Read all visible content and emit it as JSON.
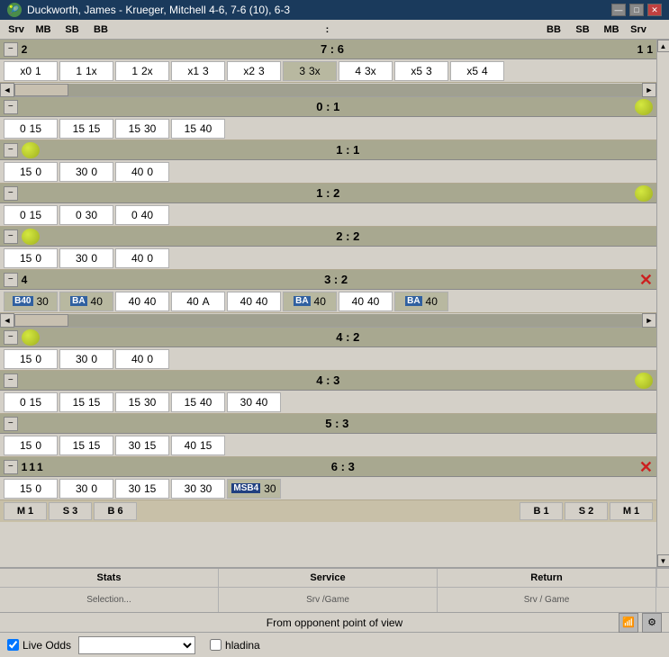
{
  "titleBar": {
    "title": "Duckworth, James - Krueger, Mitchell 4-6, 7-6 (10), 6-3",
    "icon": "🎾",
    "minimize": "—",
    "maximize": "□",
    "close": "✕"
  },
  "header": {
    "srv": "Srv",
    "mb": "MB",
    "sb": "SB",
    "bb": "BB",
    "colon": ":",
    "bb2": "BB",
    "sb2": "SB",
    "mb2": "MB",
    "srv2": "Srv"
  },
  "sets": [
    {
      "id": "set1",
      "hasBall": false,
      "score": "7 : 6",
      "leftNums": {
        "mb": "2",
        "sb": "",
        "bb": ""
      },
      "rightNums": {
        "bb": "1",
        "sb": "",
        "mb": "1"
      },
      "indicator": null,
      "games": [
        {
          "cells": [
            "x0  1",
            "1  1x",
            "1  2x",
            "x1  3",
            "x2  3",
            "3  3x",
            "4  3x",
            "x5  3",
            "x5  4"
          ],
          "highlighted": []
        }
      ],
      "hasScroll": true
    },
    {
      "id": "set2",
      "hasBall": true,
      "score": "0 : 1",
      "leftNums": {},
      "rightNums": {},
      "indicator": "ball",
      "games": [
        {
          "cells": [
            "0  15",
            "15  15",
            "15  30",
            "15  40"
          ],
          "highlighted": []
        }
      ],
      "hasScroll": false
    },
    {
      "id": "set3",
      "hasBall": true,
      "score": "1 : 1",
      "leftNums": {},
      "rightNums": {},
      "indicator": null,
      "games": [
        {
          "cells": [
            "15  0",
            "30  0",
            "40  0"
          ],
          "highlighted": []
        }
      ],
      "hasScroll": false
    },
    {
      "id": "set4",
      "hasBall": false,
      "score": "1 : 2",
      "leftNums": {},
      "rightNums": {},
      "indicator": "ball",
      "games": [
        {
          "cells": [
            "0  15",
            "0  30",
            "0  40"
          ],
          "highlighted": []
        }
      ],
      "hasScroll": false
    },
    {
      "id": "set5",
      "hasBall": true,
      "score": "2 : 2",
      "leftNums": {},
      "rightNums": {},
      "indicator": null,
      "games": [
        {
          "cells": [
            "15  0",
            "30  0",
            "40  0"
          ],
          "highlighted": []
        }
      ],
      "hasScroll": false
    },
    {
      "id": "set6",
      "hasBall": false,
      "score": "3 : 2",
      "leftNum": "4",
      "leftNums": {},
      "rightNums": {},
      "indicator": "x",
      "games": [
        {
          "cells": [
            "B40  30",
            "BA  40",
            "40  40",
            "40  A",
            "40  40",
            "BA  40",
            "40  40",
            "BA  40"
          ],
          "highlighted": [
            0,
            1,
            5,
            7
          ],
          "badges": {
            "0": "B40",
            "1": "BA",
            "5": "BA",
            "7": "BA"
          }
        }
      ],
      "hasScroll": true
    },
    {
      "id": "set7",
      "hasBall": true,
      "score": "4 : 2",
      "leftNums": {},
      "rightNums": {},
      "indicator": null,
      "games": [
        {
          "cells": [
            "15  0",
            "30  0",
            "40  0"
          ],
          "highlighted": []
        }
      ],
      "hasScroll": false
    },
    {
      "id": "set8",
      "hasBall": false,
      "score": "4 : 3",
      "leftNums": {},
      "rightNums": {},
      "indicator": "ball",
      "games": [
        {
          "cells": [
            "0  15",
            "15  15",
            "15  30",
            "15  40",
            "30  40"
          ],
          "highlighted": []
        }
      ],
      "hasScroll": false
    },
    {
      "id": "set9",
      "hasBall": false,
      "score": "5 : 3",
      "leftNums": {},
      "rightNums": {},
      "indicator": null,
      "games": [
        {
          "cells": [
            "15  0",
            "15  15",
            "30  15",
            "40  15"
          ],
          "highlighted": []
        }
      ],
      "hasScroll": false
    },
    {
      "id": "set10",
      "hasBall": false,
      "score": "6 : 3",
      "leftNum1": "1",
      "leftNum2": "1",
      "leftNum3": "1",
      "leftNums": {},
      "rightNums": {},
      "indicator": "x",
      "games": [
        {
          "cells": [
            "15  0",
            "30  0",
            "30  15",
            "30  30",
            "MSB4  30"
          ],
          "highlighted": [
            4
          ],
          "specialBadge": {
            "4": "MSB4"
          }
        }
      ],
      "hasScroll": false
    }
  ],
  "summaryRow": {
    "left": [
      "M 1",
      "S 3",
      "B 6"
    ],
    "right": [
      "B 1",
      "S 2",
      "M 1"
    ]
  },
  "stats": {
    "col1": "Stats",
    "col2": "Service",
    "col3": "Return",
    "row1": [
      "Selection...",
      "Srv /Game",
      "Srv / Game"
    ]
  },
  "infoBar": {
    "text": "From opponent point of view"
  },
  "bottomToolbar": {
    "liveOddsChecked": true,
    "liveOddsLabel": "Live Odds",
    "dropdownValue": "",
    "hladinaChecked": false,
    "hladinaLabel": "hladina"
  }
}
